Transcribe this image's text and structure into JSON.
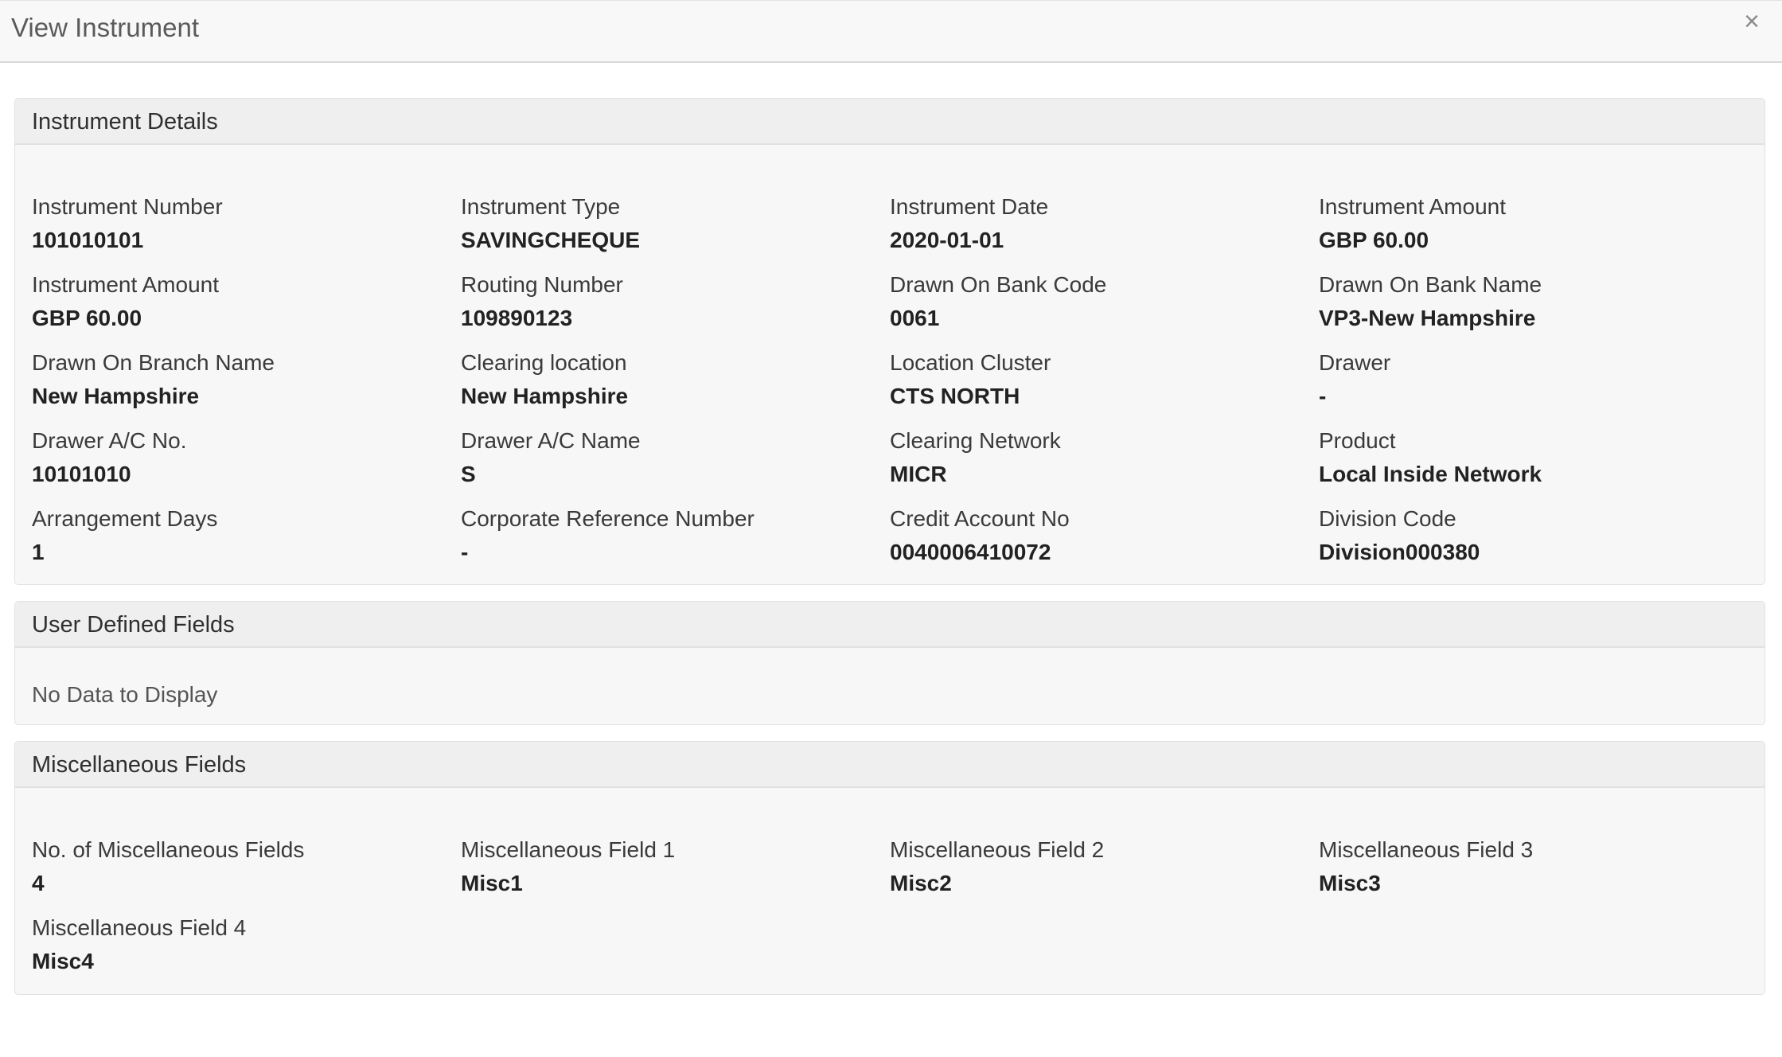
{
  "modal": {
    "title": "View Instrument",
    "close_label": "×"
  },
  "instrument_details": {
    "title": "Instrument Details",
    "fields": [
      {
        "label": "Instrument Number",
        "value": "101010101"
      },
      {
        "label": "Instrument Type",
        "value": "SAVINGCHEQUE"
      },
      {
        "label": "Instrument Date",
        "value": "2020-01-01"
      },
      {
        "label": "Instrument Amount",
        "value": "GBP 60.00"
      },
      {
        "label": "Instrument Amount",
        "value": "GBP 60.00"
      },
      {
        "label": "Routing Number",
        "value": "109890123"
      },
      {
        "label": "Drawn On Bank Code",
        "value": "0061"
      },
      {
        "label": "Drawn On Bank Name",
        "value": "VP3-New Hampshire"
      },
      {
        "label": "Drawn On Branch Name",
        "value": "New Hampshire"
      },
      {
        "label": "Clearing location",
        "value": "New Hampshire"
      },
      {
        "label": "Location Cluster",
        "value": "CTS NORTH"
      },
      {
        "label": "Drawer",
        "value": "-"
      },
      {
        "label": "Drawer A/C No.",
        "value": "10101010"
      },
      {
        "label": "Drawer A/C Name",
        "value": "S"
      },
      {
        "label": "Clearing Network",
        "value": "MICR"
      },
      {
        "label": "Product",
        "value": "Local Inside Network"
      },
      {
        "label": "Arrangement Days",
        "value": "1"
      },
      {
        "label": "Corporate Reference Number",
        "value": "-"
      },
      {
        "label": "Credit Account No",
        "value": "0040006410072"
      },
      {
        "label": "Division Code",
        "value": "Division000380"
      }
    ]
  },
  "user_defined_fields": {
    "title": "User Defined Fields",
    "empty_text": "No Data to Display"
  },
  "miscellaneous_fields": {
    "title": "Miscellaneous Fields",
    "fields": [
      {
        "label": "No. of Miscellaneous Fields",
        "value": "4"
      },
      {
        "label": "Miscellaneous Field 1",
        "value": "Misc1"
      },
      {
        "label": "Miscellaneous Field 2",
        "value": "Misc2"
      },
      {
        "label": "Miscellaneous Field 3",
        "value": "Misc3"
      },
      {
        "label": "Miscellaneous Field 4",
        "value": "Misc4"
      }
    ]
  }
}
